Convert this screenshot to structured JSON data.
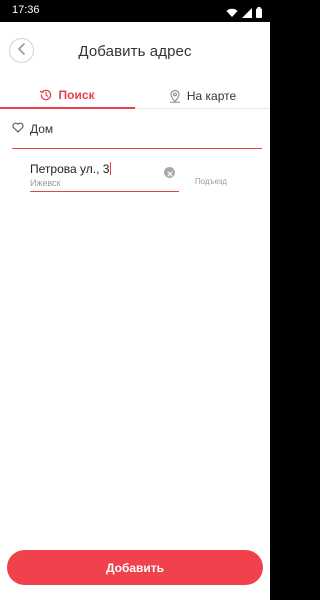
{
  "status_bar": {
    "time": "17:36",
    "icons": [
      "wifi-icon",
      "signal-icon",
      "battery-icon"
    ]
  },
  "header": {
    "title": "Добавить адрес",
    "back_icon": "chevron-left-icon"
  },
  "tabs": [
    {
      "label": "Поиск",
      "icon": "history-icon",
      "active": true
    },
    {
      "label": "На карте",
      "icon": "map-pin-icon",
      "active": false
    }
  ],
  "form": {
    "name": {
      "icon": "heart-icon",
      "value": "Дом"
    },
    "address": {
      "value": "Петрова ул., 3",
      "sublabel": "Ижевск",
      "clear_icon": "clear-icon"
    },
    "entrance": {
      "placeholder": "Подъезд"
    }
  },
  "actions": {
    "add_label": "Добавить"
  },
  "colors": {
    "accent": "#e8414c",
    "button": "#f0414c",
    "text": "#333333",
    "muted": "#9a9a9a"
  }
}
